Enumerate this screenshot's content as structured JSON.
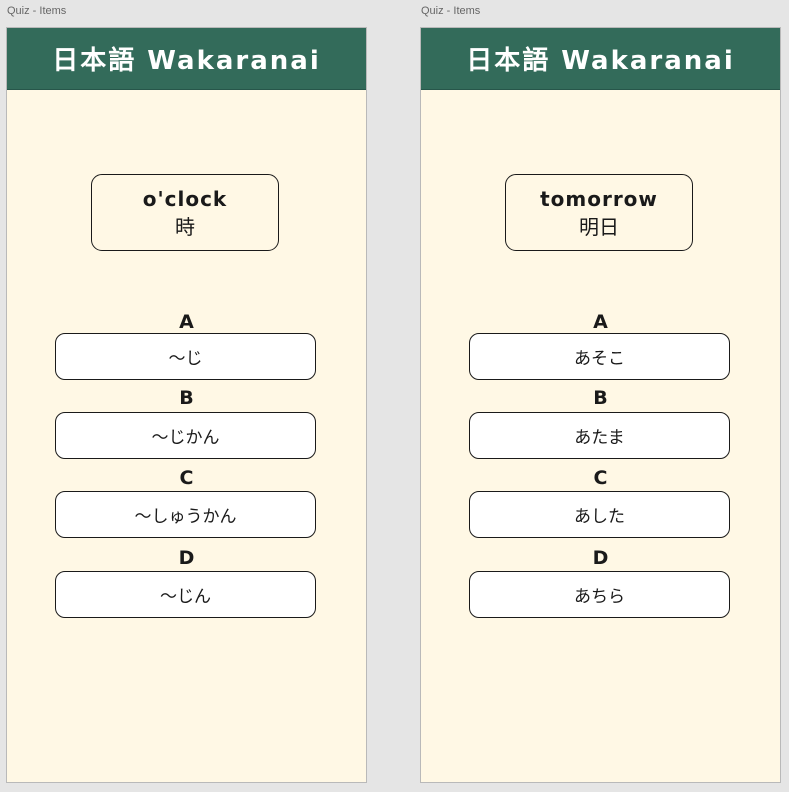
{
  "screens": [
    {
      "frame_label": "Quiz - Items",
      "header_title": "日本語  Wakaranai",
      "term": {
        "english": "o'clock",
        "japanese": "時"
      },
      "options": [
        {
          "letter": "A",
          "text": "～じ"
        },
        {
          "letter": "B",
          "text": "～じかん"
        },
        {
          "letter": "C",
          "text": "～しゅうかん"
        },
        {
          "letter": "D",
          "text": "～じん"
        }
      ]
    },
    {
      "frame_label": "Quiz - Items",
      "header_title": "日本語  Wakaranai",
      "term": {
        "english": "tomorrow",
        "japanese": "明日"
      },
      "options": [
        {
          "letter": "A",
          "text": "あそこ"
        },
        {
          "letter": "B",
          "text": "あたま"
        },
        {
          "letter": "C",
          "text": "あした"
        },
        {
          "letter": "D",
          "text": "あちら"
        }
      ]
    }
  ],
  "colors": {
    "header": "#336b5a",
    "background": "#fff8e5",
    "canvas": "#e5e5e5"
  }
}
